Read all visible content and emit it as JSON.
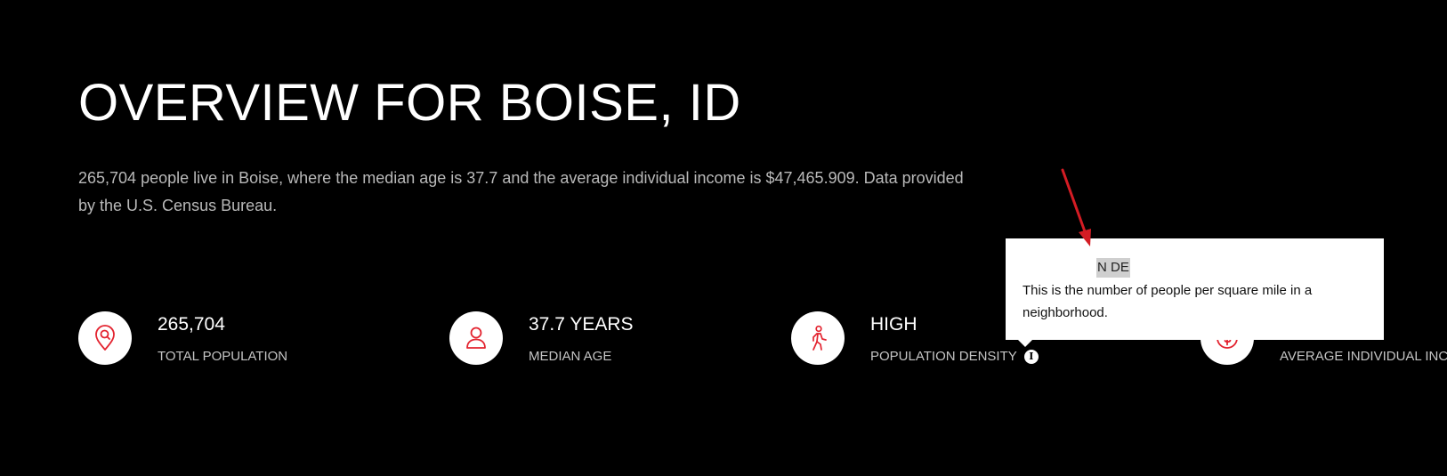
{
  "overview": {
    "title": "OVERVIEW FOR BOISE, ID",
    "description": "265,704 people live in Boise, where the median age is 37.7 and the average individual income is $47,465.909. Data provided by the U.S. Census Bureau."
  },
  "stats": [
    {
      "icon": "map-pin-search-icon",
      "value": "265,704",
      "label": "TOTAL POPULATION"
    },
    {
      "icon": "person-icon",
      "value": "37.7 YEARS",
      "label": "MEDIAN AGE"
    },
    {
      "icon": "walking-person-icon",
      "value": "HIGH",
      "label": "POPULATION DENSITY",
      "info_icon": "info-icon"
    },
    {
      "icon": "dollar-circle-icon",
      "value": "",
      "label": "AVERAGE INDIVIDUAL INCO"
    }
  ],
  "tooltip": {
    "heading": "N DE",
    "body": "This is the number of people per square mile in a neighborhood."
  },
  "colors": {
    "background": "#000000",
    "accent": "#e3232f",
    "annotation_arrow": "#d41c24",
    "text_primary": "#ffffff",
    "text_secondary": "#b9b9b9"
  }
}
